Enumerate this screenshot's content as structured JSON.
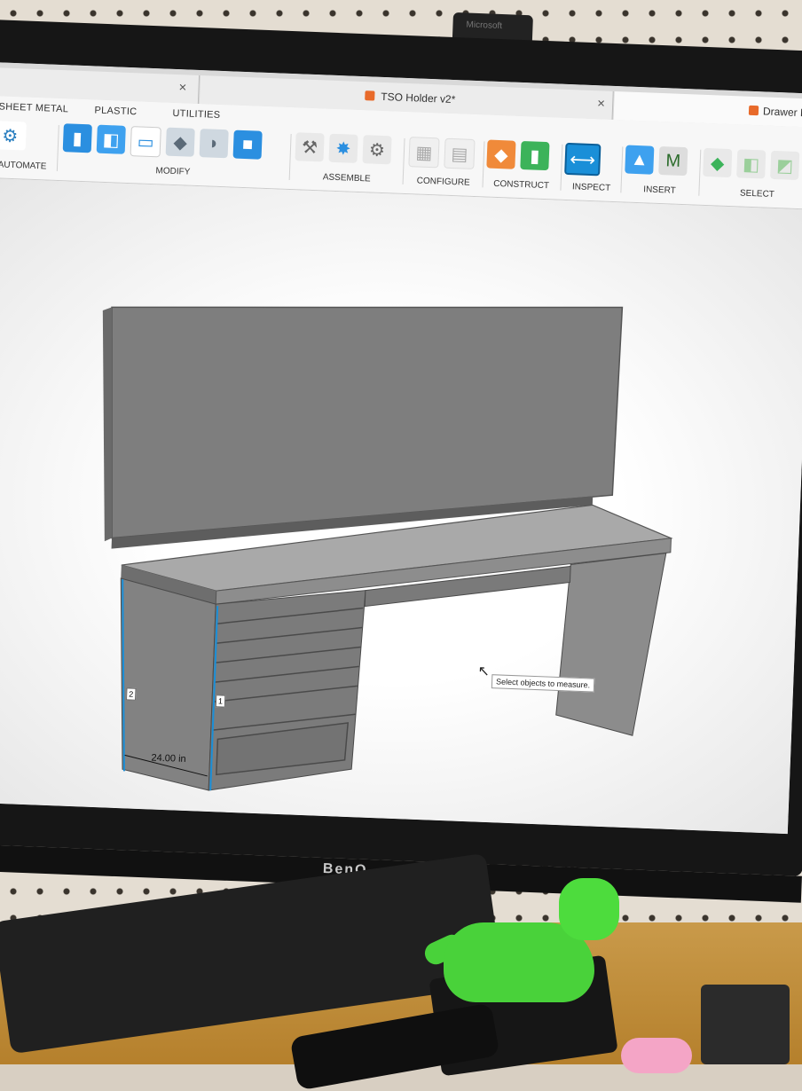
{
  "tabs": [
    {
      "label": "",
      "has_close": true
    },
    {
      "label": "TSO Holder v2*",
      "has_close": true
    },
    {
      "label": "Drawer F",
      "has_close": false
    }
  ],
  "ribbon": {
    "top_tabs": [
      "SHEET METAL",
      "PLASTIC",
      "UTILITIES"
    ],
    "groups": [
      {
        "label": "AUTOMATE",
        "icon": "automate-icon"
      },
      {
        "label": "MODIFY",
        "icon": "modify-icon"
      },
      {
        "label": "ASSEMBLE",
        "icon": "assemble-icon"
      },
      {
        "label": "CONFIGURE",
        "icon": "configure-icon"
      },
      {
        "label": "CONSTRUCT",
        "icon": "construct-icon"
      },
      {
        "label": "INSPECT",
        "icon": "measure-icon"
      },
      {
        "label": "INSERT",
        "icon": "insert-icon"
      },
      {
        "label": "SELECT",
        "icon": "select-icon"
      }
    ]
  },
  "canvas": {
    "tooltip": "Select objects to measure.",
    "dimension_label": "24.00 in",
    "marker_1": "1",
    "marker_2": "2"
  },
  "colors": {
    "model_gray": "#8a8a8a",
    "accent_blue": "#1a8fd8",
    "ui_bg": "#f7f7f7"
  },
  "hardware": {
    "monitor_brand": "BenQ",
    "webcam_brand": "Microsoft"
  }
}
